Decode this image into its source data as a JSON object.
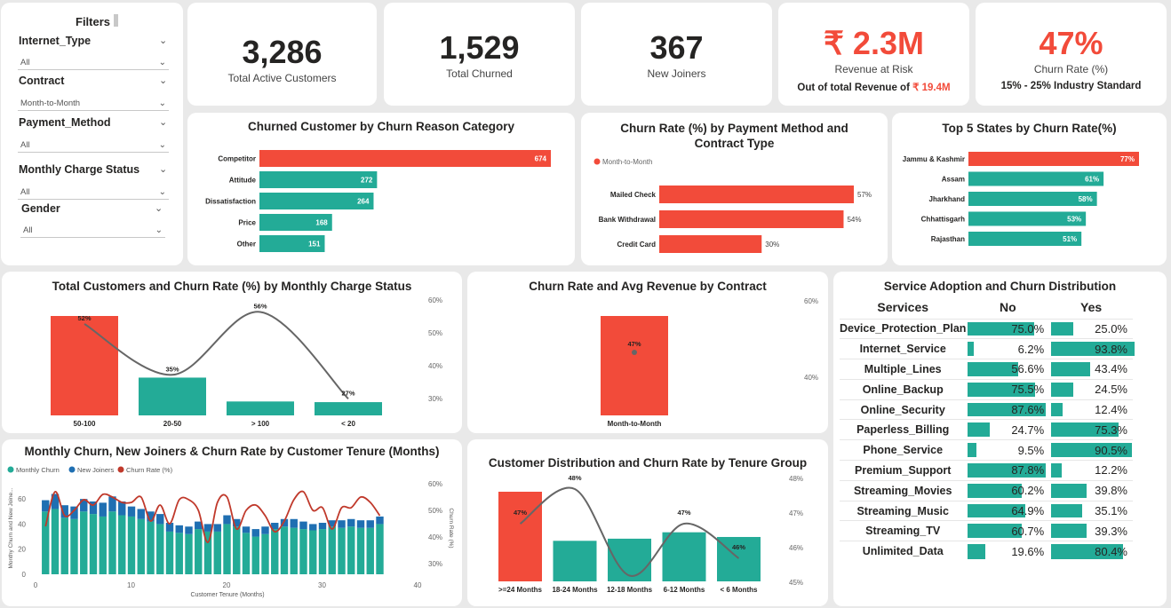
{
  "filters": {
    "title": "Filters",
    "items": [
      {
        "label": "Internet_Type",
        "value": "All"
      },
      {
        "label": "Contract",
        "value": "Month-to-Month"
      },
      {
        "label": "Payment_Method",
        "value": "All"
      },
      {
        "label": "Monthly Charge Status",
        "value": "All"
      },
      {
        "label": "Gender",
        "value": "All"
      }
    ]
  },
  "kpis": {
    "active": {
      "value": "3,286",
      "label": "Total Active Customers"
    },
    "churned": {
      "value": "1,529",
      "label": "Total Churned"
    },
    "joiners": {
      "value": "367",
      "label": "New Joiners"
    },
    "revenue": {
      "value": "₹ 2.3M",
      "label": "Revenue at Risk",
      "sub_prefix": "Out of total Revenue of",
      "sub_value": "₹ 19.4M"
    },
    "churn_rate": {
      "value": "47%",
      "label": "Churn Rate (%)",
      "sub": "15% - 25% Industry Standard"
    }
  },
  "colors": {
    "accent_red": "#f24b3a",
    "teal": "#23ab97",
    "blue": "#1f6fb2",
    "line_gray": "#666666",
    "line_red": "#c0392b"
  },
  "chart_data": [
    {
      "id": "churn_reason",
      "type": "bar",
      "orientation": "horizontal",
      "title": "Churned Customer by Churn Reason Category",
      "categories": [
        "Competitor",
        "Attitude",
        "Dissatisfaction",
        "Price",
        "Other"
      ],
      "values": [
        674,
        272,
        264,
        168,
        151
      ],
      "highlight": [
        "Competitor"
      ]
    },
    {
      "id": "payment_contract",
      "type": "bar",
      "orientation": "horizontal",
      "title": "Churn Rate (%) by Payment Method and Contract Type",
      "legend": [
        "Month-to-Month"
      ],
      "categories": [
        "Mailed Check",
        "Bank Withdrawal",
        "Credit Card"
      ],
      "values": [
        57,
        54,
        30
      ],
      "labels": [
        "57%",
        "54%",
        "30%"
      ]
    },
    {
      "id": "top_states",
      "type": "bar",
      "orientation": "horizontal",
      "title": "Top 5 States by Churn Rate(%)",
      "categories": [
        "Jammu & Kashmir",
        "Assam",
        "Jharkhand",
        "Chhattisgarh",
        "Rajasthan"
      ],
      "values": [
        77,
        61,
        58,
        53,
        51
      ],
      "labels": [
        "77%",
        "61%",
        "58%",
        "53%",
        "51%"
      ],
      "highlight": [
        "Jammu & Kashmir"
      ]
    },
    {
      "id": "monthly_charge_status",
      "type": "bar",
      "title": "Total Customers and Churn Rate (%) by Monthly Charge Status",
      "categories": [
        "50-100",
        "20-50",
        "> 100",
        "< 20"
      ],
      "bar_values": [
        1500,
        570,
        210,
        200
      ],
      "line_values": [
        52,
        35,
        56,
        27
      ],
      "line_labels": [
        "52%",
        "35%",
        "56%",
        "27%"
      ],
      "y2_ticks": [
        "60%",
        "50%",
        "40%",
        "30%"
      ],
      "y2lim": [
        25,
        60
      ]
    },
    {
      "id": "contract_revenue",
      "type": "bar",
      "title": "Churn Rate and Avg Revenue by Contract",
      "categories": [
        "Month-to-Month"
      ],
      "bar_values": [
        100
      ],
      "line_values": [
        47
      ],
      "line_labels": [
        "47%"
      ],
      "y2_ticks": [
        "60%",
        "40%"
      ]
    },
    {
      "id": "tenure_monthly",
      "type": "bar",
      "title": "Monthly Churn, New Joiners & Churn Rate by Customer Tenure (Months)",
      "legend": [
        "Monthly Churn",
        "New Joiners",
        "Churn Rate (%)"
      ],
      "ylabel": "Monthy Churn and New Joine...",
      "y2label": "Churn Rate (%)",
      "xlabel": "Customer Tenure (Months)",
      "x_ticks": [
        "0",
        "10",
        "20",
        "30",
        "40"
      ],
      "y_ticks": [
        "60",
        "40",
        "20",
        "0"
      ],
      "y2_ticks": [
        "60%",
        "50%",
        "40%",
        "30%"
      ],
      "x": [
        1,
        2,
        3,
        4,
        5,
        6,
        7,
        8,
        9,
        10,
        11,
        12,
        13,
        14,
        15,
        16,
        17,
        18,
        19,
        20,
        21,
        22,
        23,
        24,
        25,
        26,
        27,
        28,
        29,
        30,
        31,
        32,
        33,
        34,
        35,
        36
      ],
      "churn": [
        50,
        52,
        45,
        44,
        50,
        48,
        46,
        50,
        47,
        46,
        44,
        42,
        40,
        34,
        33,
        32,
        36,
        34,
        34,
        40,
        38,
        33,
        30,
        32,
        36,
        38,
        37,
        36,
        35,
        36,
        38,
        37,
        38,
        37,
        37,
        40
      ],
      "joiners": [
        9,
        12,
        10,
        10,
        10,
        10,
        11,
        12,
        11,
        8,
        8,
        8,
        8,
        7,
        6,
        6,
        6,
        6,
        6,
        7,
        6,
        5,
        6,
        6,
        5,
        6,
        7,
        6,
        5,
        5,
        5,
        6,
        6,
        6,
        6,
        6
      ],
      "rate": [
        44,
        57,
        48,
        50,
        54,
        52,
        56,
        55,
        53,
        53,
        55,
        46,
        52,
        45,
        54,
        54,
        50,
        38,
        53,
        55,
        43,
        50,
        52,
        48,
        42,
        46,
        54,
        57,
        50,
        51,
        43,
        51,
        51,
        55,
        53,
        48
      ]
    },
    {
      "id": "tenure_group",
      "type": "bar",
      "title": "Customer Distribution and Churn Rate by Tenure Group",
      "categories": [
        ">=24 Months",
        "18-24 Months",
        "12-18 Months",
        "6-12 Months",
        "< 6 Months"
      ],
      "bar_values": [
        420,
        190,
        200,
        230,
        208
      ],
      "line_values": [
        47,
        48,
        45.5,
        47,
        46
      ],
      "line_labels": [
        "47%",
        "48%",
        "",
        "47%",
        "46%"
      ],
      "y2_ticks": [
        "48%",
        "47%",
        "46%",
        "45%"
      ],
      "y2lim": [
        45,
        48
      ]
    }
  ],
  "services": {
    "title": "Service Adoption and Churn Distribution",
    "headers": [
      "Services",
      "No",
      "Yes"
    ],
    "rows": [
      {
        "name": "Device_Protection_Plan",
        "no": "75.0%",
        "yes": "25.0%",
        "no_v": 75.0,
        "yes_v": 25.0
      },
      {
        "name": "Internet_Service",
        "no": "6.2%",
        "yes": "93.8%",
        "no_v": 6.2,
        "yes_v": 93.8
      },
      {
        "name": "Multiple_Lines",
        "no": "56.6%",
        "yes": "43.4%",
        "no_v": 56.6,
        "yes_v": 43.4
      },
      {
        "name": "Online_Backup",
        "no": "75.5%",
        "yes": "24.5%",
        "no_v": 75.5,
        "yes_v": 24.5
      },
      {
        "name": "Online_Security",
        "no": "87.6%",
        "yes": "12.4%",
        "no_v": 87.6,
        "yes_v": 12.4
      },
      {
        "name": "Paperless_Billing",
        "no": "24.7%",
        "yes": "75.3%",
        "no_v": 24.7,
        "yes_v": 75.3
      },
      {
        "name": "Phone_Service",
        "no": "9.5%",
        "yes": "90.5%",
        "no_v": 9.5,
        "yes_v": 90.5
      },
      {
        "name": "Premium_Support",
        "no": "87.8%",
        "yes": "12.2%",
        "no_v": 87.8,
        "yes_v": 12.2
      },
      {
        "name": "Streaming_Movies",
        "no": "60.2%",
        "yes": "39.8%",
        "no_v": 60.2,
        "yes_v": 39.8
      },
      {
        "name": "Streaming_Music",
        "no": "64.9%",
        "yes": "35.1%",
        "no_v": 64.9,
        "yes_v": 35.1
      },
      {
        "name": "Streaming_TV",
        "no": "60.7%",
        "yes": "39.3%",
        "no_v": 60.7,
        "yes_v": 39.3
      },
      {
        "name": "Unlimited_Data",
        "no": "19.6%",
        "yes": "80.4%",
        "no_v": 19.6,
        "yes_v": 80.4
      }
    ]
  }
}
